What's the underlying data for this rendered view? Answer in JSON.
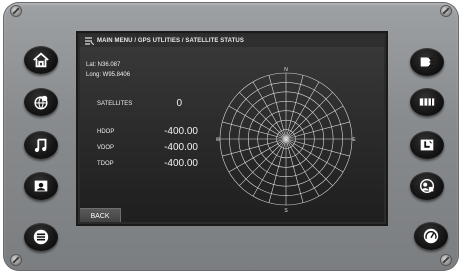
{
  "breadcrumb": "MAIN MENU / GPS UTLITIES / SATELLITE STATUS",
  "location": {
    "lat": "Lat: N36.087",
    "long": "Long: W95.8406"
  },
  "satellites": {
    "label": "SATELLITES",
    "value": "0"
  },
  "dop": [
    {
      "label": "HDOP",
      "value": "-400.00"
    },
    {
      "label": "VDOP",
      "value": "-400.00"
    },
    {
      "label": "TDOP",
      "value": "-400.00"
    }
  ],
  "sky_plot": {
    "n": "N",
    "e": "E",
    "s": "S",
    "w": "W"
  },
  "back_label": "BACK",
  "icons": {
    "left": [
      "home-icon",
      "globe-location-icon",
      "music-note-icon",
      "contact-card-icon",
      "menu-icon"
    ],
    "right": [
      "headlight-icon",
      "battery-icon",
      "seat-heat-icon",
      "gps-person-icon",
      "gauge-icon"
    ]
  },
  "colors": {
    "bezel": "#8c8f92",
    "screen": "#2f2f2f",
    "text": "#eeeeee",
    "button": "#111111"
  }
}
